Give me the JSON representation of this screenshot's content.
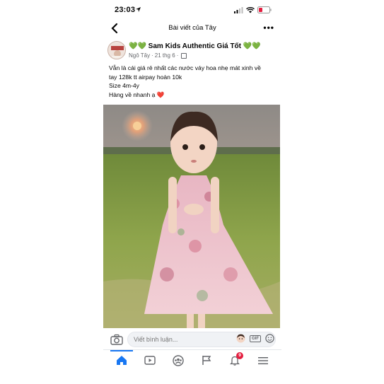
{
  "status_bar": {
    "time": "23:03"
  },
  "nav": {
    "back_label": "‹",
    "title": "Bài viết của Tây",
    "more_label": "•••"
  },
  "post": {
    "page_name": "💚💚 Sam Kids Authentic Giá Tốt 💚💚",
    "author": "Ngô Tây",
    "date": "21 thg 6",
    "caption_lines": [
      "Vẫn là cái giá rẻ nhất các nước váy hoa nhẹ mát xinh về",
      "tay 128k tt airpay hoàn 10k",
      "Size 4m-4y",
      "Hàng về nhanh ạ ❤️"
    ]
  },
  "comment_bar": {
    "placeholder": "Viết bình luận..."
  },
  "tabs": {
    "items": [
      "home-icon",
      "watch-icon",
      "groups-icon",
      "pages-flag-icon",
      "notifications-bell-icon",
      "menu-icon"
    ],
    "notification_count": "9",
    "active": "home-icon"
  },
  "colors": {
    "accent": "#1877f2",
    "badge": "#e41e3f",
    "muted": "#65676b"
  }
}
